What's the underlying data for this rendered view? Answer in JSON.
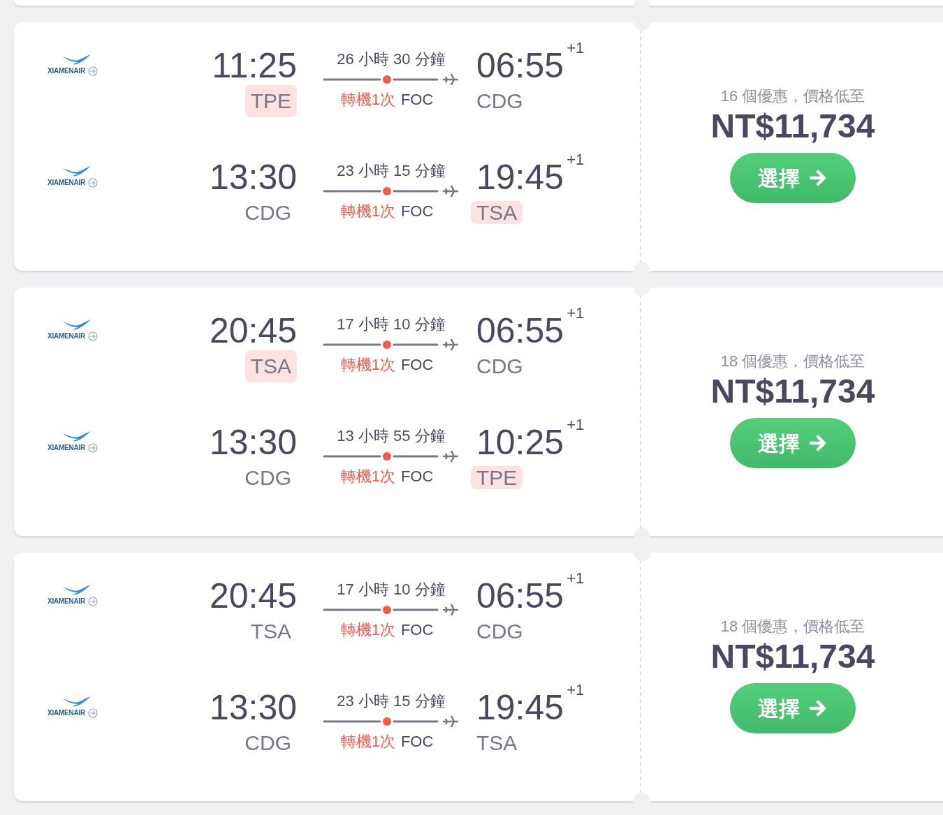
{
  "results": [
    {
      "legs": [
        {
          "airline": "XIAMENAIR",
          "depart_time": "11:25",
          "depart_airport": "TPE",
          "depart_highlighted": true,
          "duration": "26 小時 30 分鐘",
          "stops": "轉機1次",
          "via": "FOC",
          "arrive_time": "06:55",
          "day_offset": "+1",
          "arrive_airport": "CDG",
          "arrive_highlighted": false
        },
        {
          "airline": "XIAMENAIR",
          "depart_time": "13:30",
          "depart_airport": "CDG",
          "depart_highlighted": false,
          "duration": "23 小時 15 分鐘",
          "stops": "轉機1次",
          "via": "FOC",
          "arrive_time": "19:45",
          "day_offset": "+1",
          "arrive_airport": "TSA",
          "arrive_highlighted": true
        }
      ],
      "deals": "16 個優惠，價格低至",
      "price": "NT$11,734",
      "button": "選擇"
    },
    {
      "legs": [
        {
          "airline": "XIAMENAIR",
          "depart_time": "20:45",
          "depart_airport": "TSA",
          "depart_highlighted": true,
          "duration": "17 小時 10 分鐘",
          "stops": "轉機1次",
          "via": "FOC",
          "arrive_time": "06:55",
          "day_offset": "+1",
          "arrive_airport": "CDG",
          "arrive_highlighted": false
        },
        {
          "airline": "XIAMENAIR",
          "depart_time": "13:30",
          "depart_airport": "CDG",
          "depart_highlighted": false,
          "duration": "13 小時 55 分鐘",
          "stops": "轉機1次",
          "via": "FOC",
          "arrive_time": "10:25",
          "day_offset": "+1",
          "arrive_airport": "TPE",
          "arrive_highlighted": true
        }
      ],
      "deals": "18 個優惠，價格低至",
      "price": "NT$11,734",
      "button": "選擇"
    },
    {
      "legs": [
        {
          "airline": "XIAMENAIR",
          "depart_time": "20:45",
          "depart_airport": "TSA",
          "depart_highlighted": false,
          "duration": "17 小時 10 分鐘",
          "stops": "轉機1次",
          "via": "FOC",
          "arrive_time": "06:55",
          "day_offset": "+1",
          "arrive_airport": "CDG",
          "arrive_highlighted": false
        },
        {
          "airline": "XIAMENAIR",
          "depart_time": "13:30",
          "depart_airport": "CDG",
          "depart_highlighted": false,
          "duration": "23 小時 15 分鐘",
          "stops": "轉機1次",
          "via": "FOC",
          "arrive_time": "19:45",
          "day_offset": "+1",
          "arrive_airport": "TSA",
          "arrive_highlighted": false
        }
      ],
      "deals": "18 個優惠，價格低至",
      "price": "NT$11,734",
      "button": "選擇"
    }
  ]
}
